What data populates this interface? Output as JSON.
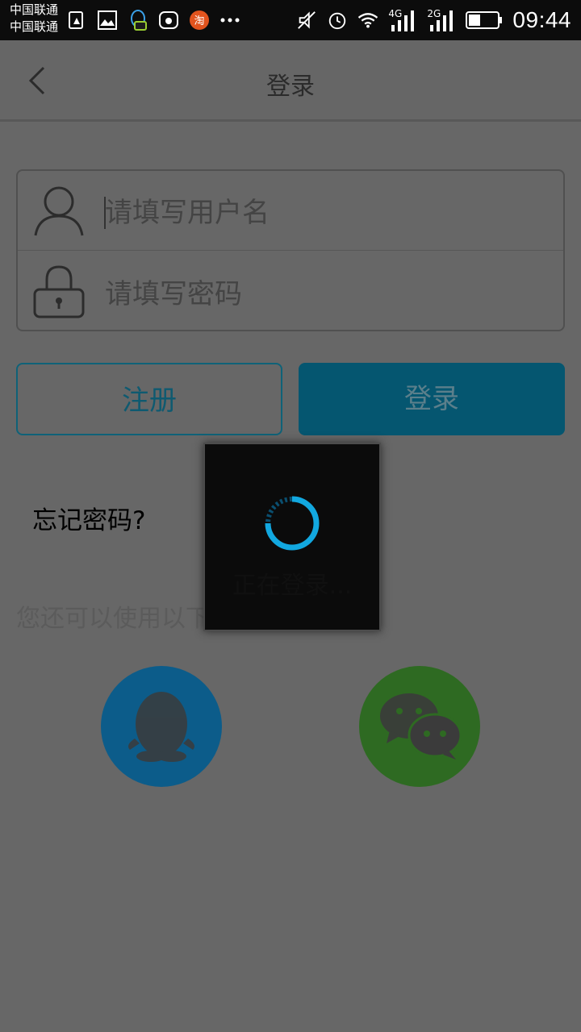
{
  "status_bar": {
    "carrier1": "中国联通",
    "carrier2": "中国联通",
    "network1": "4G",
    "network2": "2G",
    "time": "09:44",
    "icons": [
      "sim-card-warning-icon",
      "gallery-icon",
      "qq-notification-icon",
      "huawei-store-icon",
      "taobao-icon",
      "more-dots-icon",
      "mute-icon",
      "alarm-icon",
      "wifi-icon",
      "signal-4g-icon",
      "signal-2g-icon",
      "battery-icon"
    ]
  },
  "header": {
    "title": "登录"
  },
  "form": {
    "username_placeholder": "请填写用户名",
    "password_placeholder": "请填写密码"
  },
  "buttons": {
    "register": "注册",
    "login": "登录"
  },
  "links": {
    "forgot_password": "忘记密码?"
  },
  "alt_login_text": "您还可以使用以下方式登录",
  "social": [
    "qq-icon",
    "wechat-icon"
  ],
  "dialog": {
    "text": "正在登录..."
  },
  "colors": {
    "accent": "#0a97c8",
    "qq": "#1b8fd6",
    "wechat": "#47b936"
  }
}
